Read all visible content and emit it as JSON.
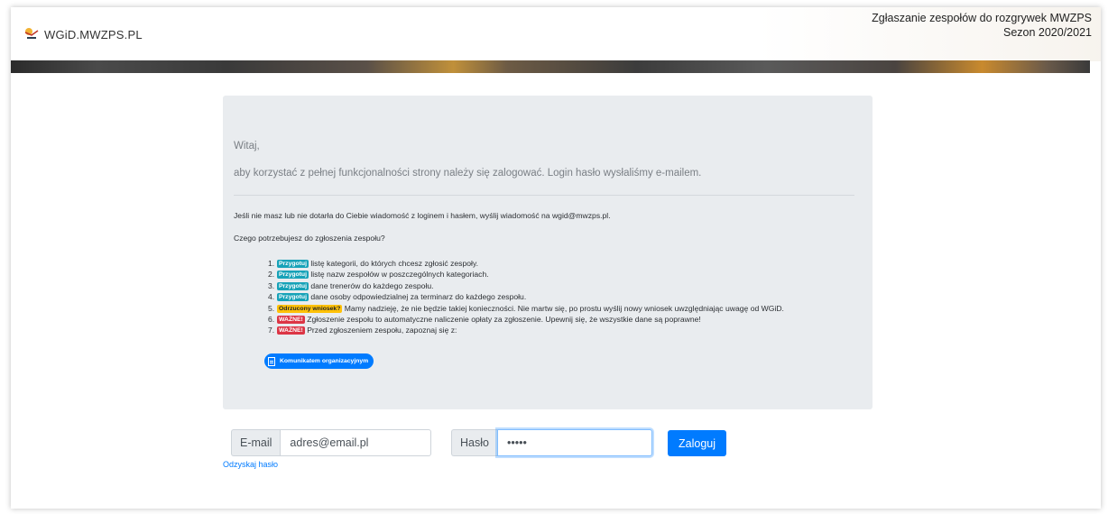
{
  "header": {
    "brand": "WGiD.MWZPS.PL",
    "title_line1": "Zgłaszanie zespołów do rozgrywek MWZPS",
    "title_line2": "Sezon 2020/2021"
  },
  "panel": {
    "greeting": "Witaj,",
    "lead": "aby korzystać z pełnej funkcjonalności strony należy się zalogować. Login hasło wysłaliśmy e-mailem.",
    "info": "Jeśli nie masz lub nie dotarła do Ciebie wiadomość z loginem i hasłem, wyślij wiadomość na wgid@mwzps.pl.",
    "need": "Czego potrzebujesz do zgłoszenia zespołu?",
    "steps": [
      {
        "num": "1.",
        "badge": "Przygotuj",
        "text": "listę kategorii, do których chcesz zgłosić zespoły."
      },
      {
        "num": "2.",
        "badge": "Przygotuj",
        "text": "listę nazw zespołów w poszczególnych kategoriach."
      },
      {
        "num": "3.",
        "badge": "Przygotuj",
        "text": "dane trenerów do każdego zespołu."
      },
      {
        "num": "4.",
        "badge": "Przygotuj",
        "text": "dane osoby odpowiedzialnej za terminarz do każdego zespołu."
      },
      {
        "num": "5.",
        "badge": "Odrzucony wniosek?",
        "text": "Mamy nadzieję, że nie będzie takiej konieczności. Nie martw się, po prostu wyślij nowy wniosek uwzględniając uwagę od WGiD."
      },
      {
        "num": "6.",
        "badge": "WAŻNE!",
        "text": "Zgłoszenie zespołu to automatyczne naliczenie opłaty za zgłoszenie. Upewnij się, że wszystkie dane są poprawne!"
      },
      {
        "num": "7.",
        "badge": "WAŻNE!",
        "text": "Przed zgłoszeniem zespołu, zapoznaj się z:"
      }
    ],
    "doc_button": "Komunikatem organizacyjnym"
  },
  "login": {
    "email_label": "E-mail",
    "email_value": "adres@email.pl",
    "password_label": "Hasło",
    "password_value": "•••••",
    "submit": "Zaloguj",
    "recover": "Odzyskaj hasło"
  },
  "colors": {
    "primary": "#007bff",
    "info_badge": "#17a2b8",
    "warning_badge": "#ffc107",
    "danger_badge": "#dc3545",
    "panel_bg": "#e9ecef"
  }
}
